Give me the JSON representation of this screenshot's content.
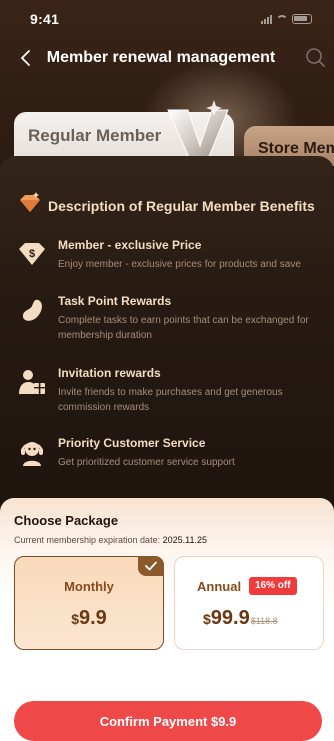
{
  "status_bar": {
    "time": "9:41"
  },
  "nav": {
    "title": "Member renewal management"
  },
  "tabs": {
    "regular": "Regular Member",
    "store": "Store Member"
  },
  "benefits": {
    "title": "Description of Regular Member Benefits",
    "items": [
      {
        "icon": "price-tag-icon",
        "title": "Member - exclusive Price",
        "desc": "Enjoy member - exclusive prices for products and save"
      },
      {
        "icon": "bean-icon",
        "title": "Task Point Rewards",
        "desc": "Complete tasks to earn points that can be exchanged for membership duration"
      },
      {
        "icon": "invite-gift-icon",
        "title": "Invitation rewards",
        "desc": "Invite friends to make purchases and get generous commission rewards"
      },
      {
        "icon": "headset-icon",
        "title": "Priority Customer Service",
        "desc": "Get prioritized customer service support"
      }
    ]
  },
  "package": {
    "title": "Choose Package",
    "expiry_label": "Current membership expiration date:",
    "expiry_date": "2025.11.25",
    "plans": [
      {
        "name": "Monthly",
        "currency": "$",
        "amount": "9.9",
        "selected": true
      },
      {
        "name": "Annual",
        "currency": "$",
        "amount": "99.9",
        "old_price": "$118.8",
        "badge": "16% off",
        "selected": false
      }
    ]
  },
  "confirm": {
    "label": "Confirm Payment $9.9"
  },
  "colors": {
    "accent_red": "#ef4848",
    "gold_text": "#f3dcc2",
    "brown_dark": "#2a1a10",
    "plan_border": "#7a4a22"
  }
}
